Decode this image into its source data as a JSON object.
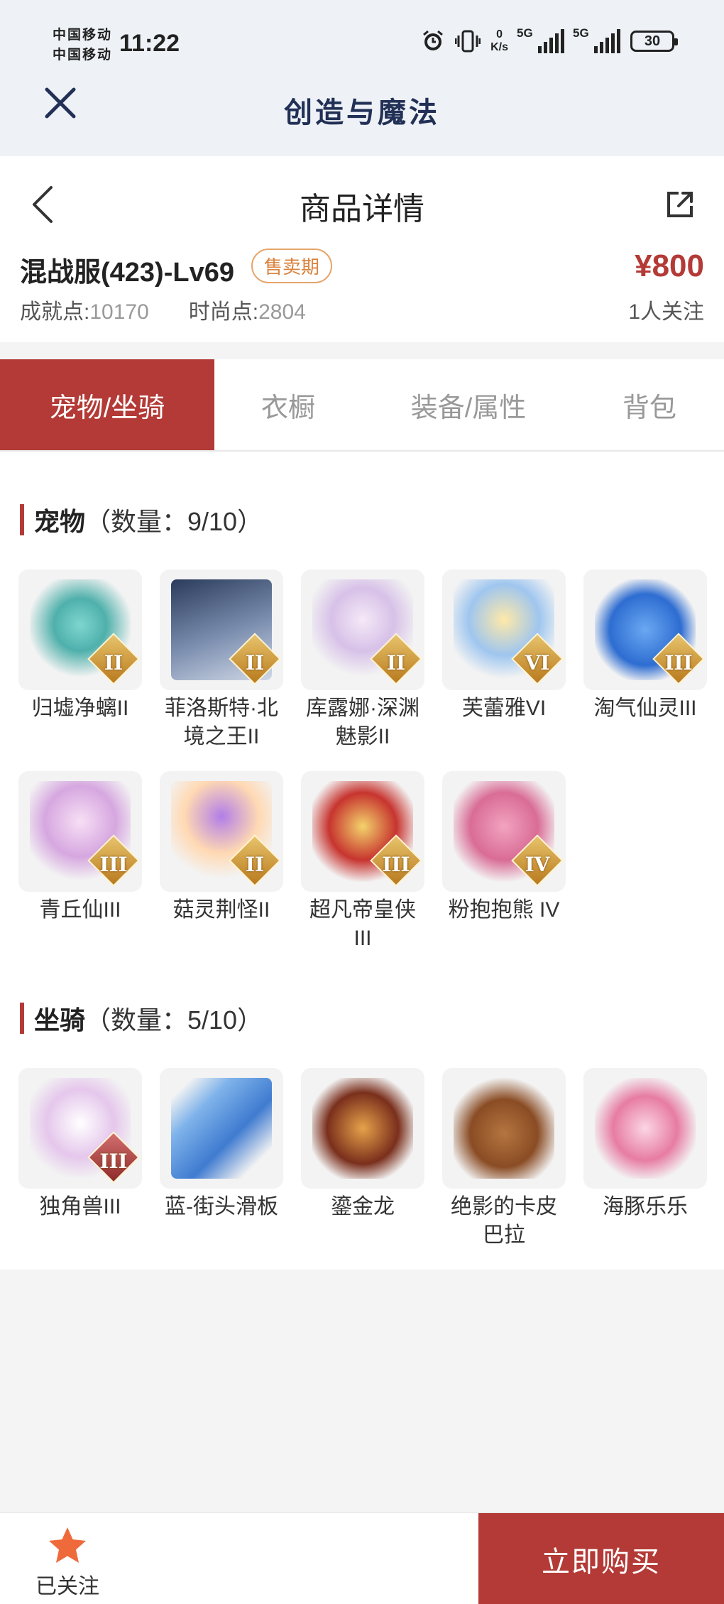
{
  "status_bar": {
    "carrier_1": "中国移动",
    "carrier_2": "中国移动",
    "time": "11:22",
    "net_speed_value": "0",
    "net_speed_unit": "K/s",
    "sig1_label": "5G",
    "sig2_label": "5G",
    "battery": "30"
  },
  "app_bar": {
    "title": "创造与魔法"
  },
  "header": {
    "title": "商品详情",
    "server": "混战服(423)-Lv69",
    "badge": "售卖期",
    "price": "¥800",
    "achievement_label": "成就点:",
    "achievement_value": "10170",
    "fashion_label": "时尚点:",
    "fashion_value": "2804",
    "followers": "1人关注"
  },
  "tabs": [
    {
      "label": "宠物/坐骑",
      "active": true
    },
    {
      "label": "衣橱",
      "active": false
    },
    {
      "label": "装备/属性",
      "active": false
    },
    {
      "label": "背包",
      "active": false
    }
  ],
  "pets": {
    "title": "宠物",
    "count": "（数量：9/10）",
    "items": [
      {
        "name": "归墟净螭II",
        "rank": "II"
      },
      {
        "name": "菲洛斯特·北境之王II",
        "rank": "II"
      },
      {
        "name": "库露娜·深渊魅影II",
        "rank": "II"
      },
      {
        "name": "芙蕾雅VI",
        "rank": "VI"
      },
      {
        "name": "淘气仙灵III",
        "rank": "III"
      },
      {
        "name": "青丘仙III",
        "rank": "III"
      },
      {
        "name": "菇灵荆怪II",
        "rank": "II"
      },
      {
        "name": "超凡帝皇侠III",
        "rank": "III"
      },
      {
        "name": "粉抱抱熊 IV",
        "rank": "IV"
      }
    ]
  },
  "mounts": {
    "title": "坐骑",
    "count": "（数量：5/10）",
    "items": [
      {
        "name": "独角兽III",
        "rank": "III"
      },
      {
        "name": "蓝-街头滑板",
        "rank": ""
      },
      {
        "name": "鎏金龙",
        "rank": ""
      },
      {
        "name": "绝影的卡皮巴拉",
        "rank": ""
      },
      {
        "name": "海豚乐乐",
        "rank": ""
      }
    ]
  },
  "bottom_bar": {
    "follow_label": "已关注",
    "buy_label": "立即购买"
  },
  "colors": {
    "accent": "#b33a36",
    "badge": "#d9823d",
    "title_navy": "#223056"
  }
}
